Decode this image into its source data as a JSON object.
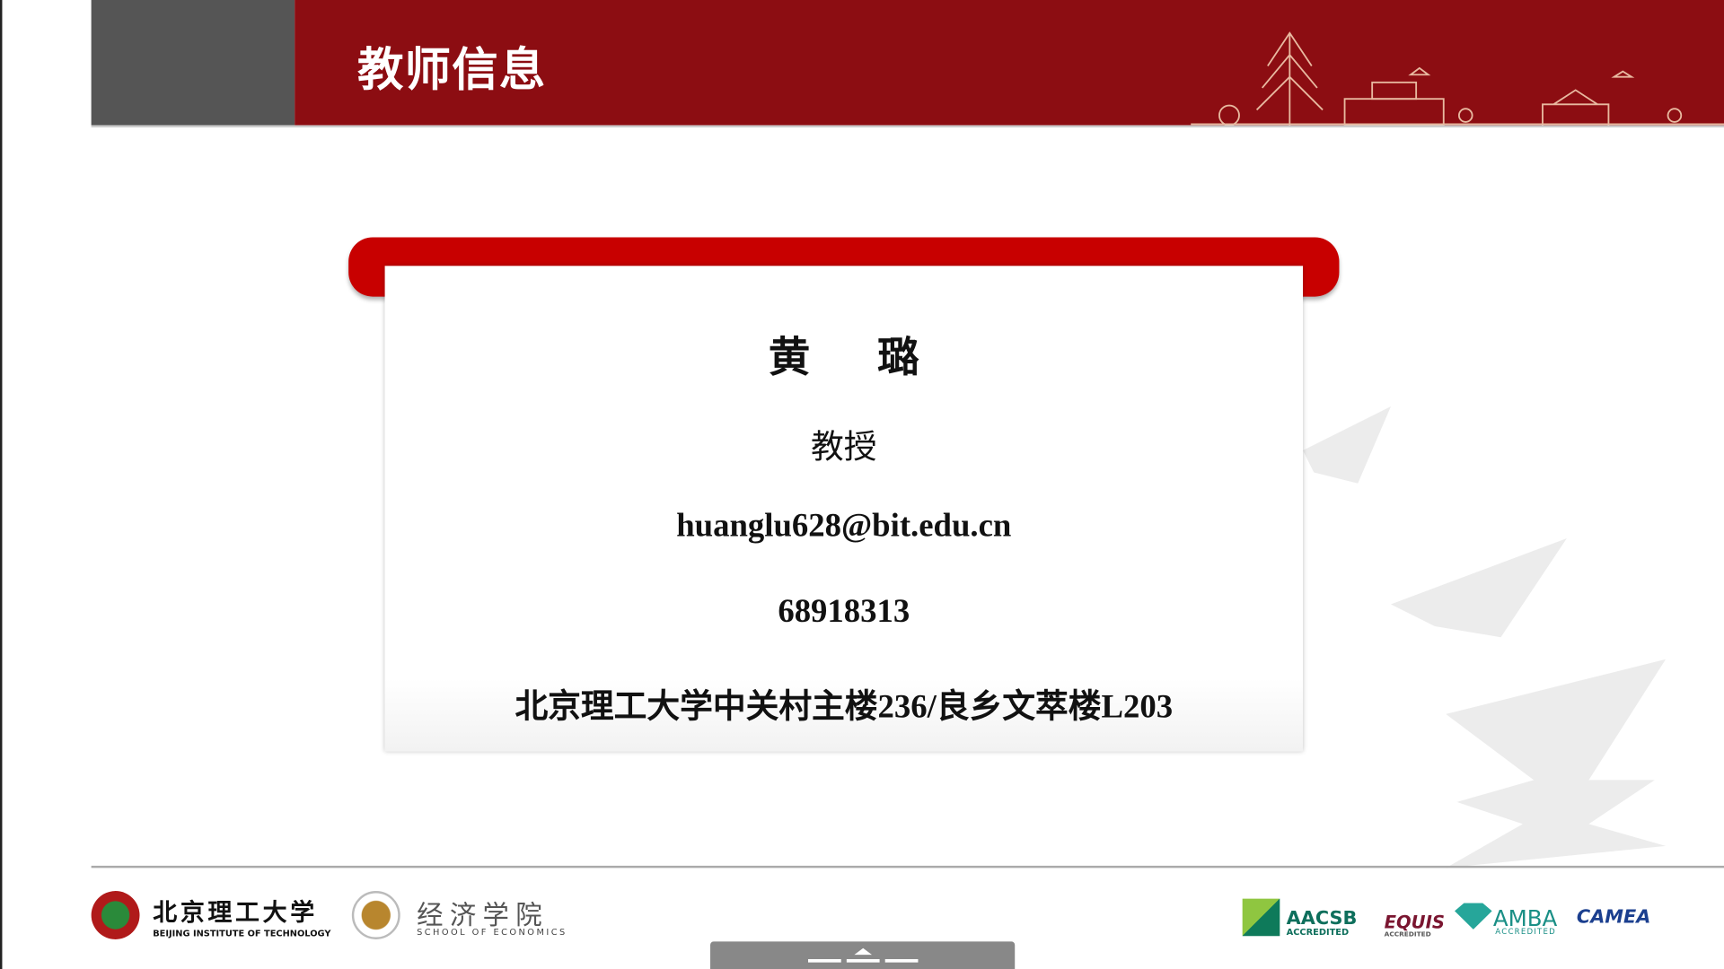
{
  "header": {
    "title": "教师信息"
  },
  "teacher": {
    "name": "黄 璐",
    "title": "教授",
    "email": "huanglu628@bit.edu.cn",
    "phone": "68918313",
    "address": "北京理工大学中关村主楼236/良乡文萃楼L203"
  },
  "footer": {
    "bit_cn": "北京理工大学",
    "bit_en": "BEIJING INSTITUTE OF TECHNOLOGY",
    "school_cn": "经济学院",
    "school_en": "SCHOOL OF ECONOMICS",
    "accreditations": [
      "AACSB",
      "ACCREDITED",
      "EQUIS",
      "ACCREDITED",
      "AMBA",
      "ACCREDITED",
      "CAMEA"
    ]
  },
  "colors": {
    "header_red": "#8c0d12",
    "scroll_red": "#c80000",
    "gray_block": "#555555"
  }
}
